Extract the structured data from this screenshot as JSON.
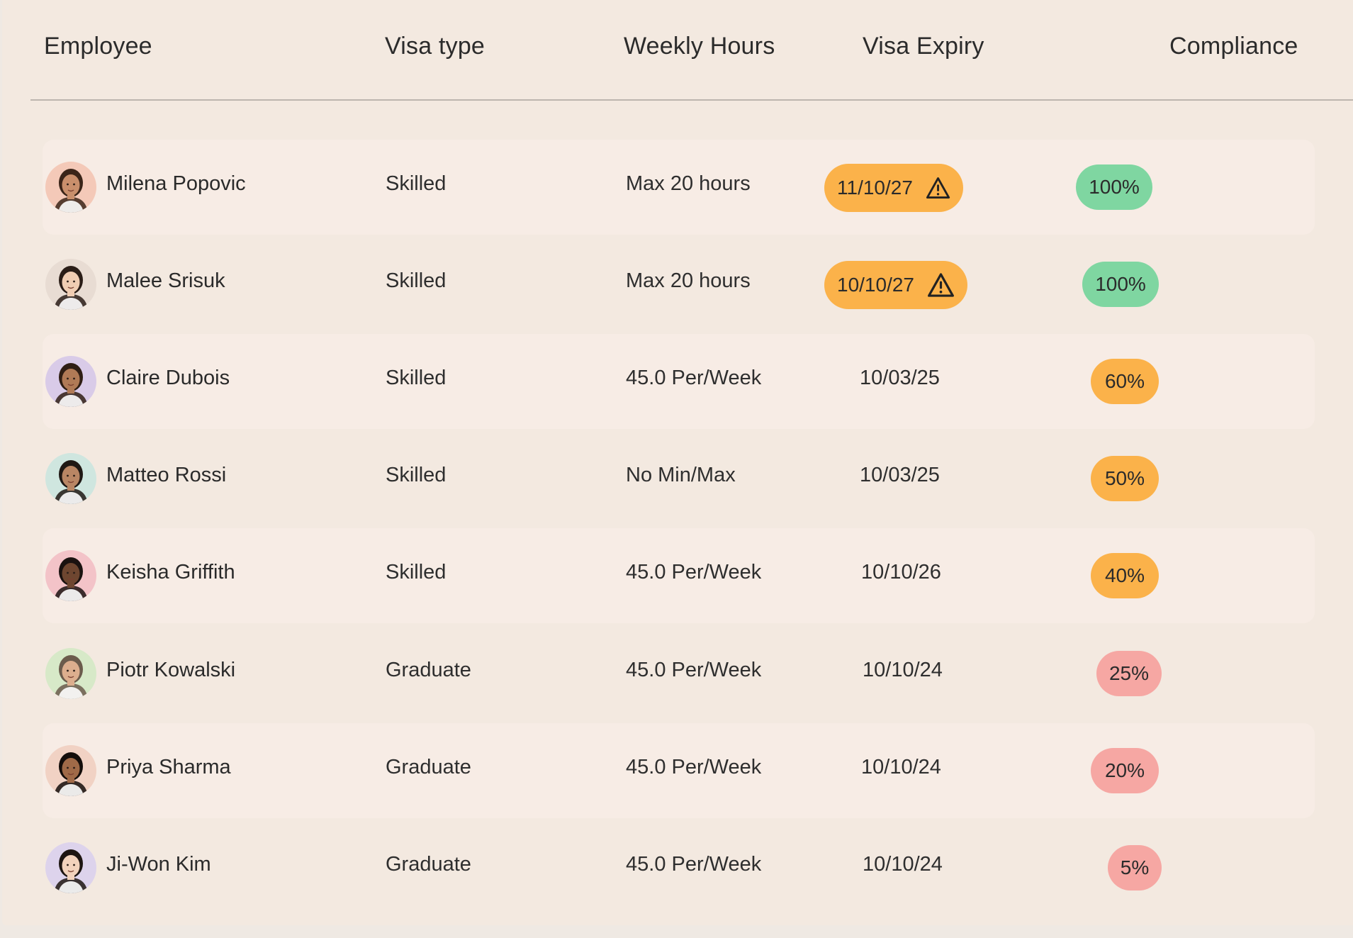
{
  "header": {
    "employee": "Employee",
    "visa_type": "Visa type",
    "weekly_hours": "Weekly Hours",
    "visa_expiry": "Visa Expiry",
    "compliance": "Compliance"
  },
  "colors": {
    "warning": "#fbb24a",
    "good": "#7fd6a1",
    "medium": "#fbb24a",
    "bad": "#f6a7a3"
  },
  "rows": [
    {
      "name": "Milena Popovic",
      "visa": "Skilled",
      "hours": "Max 20 hours",
      "expiry": "11/10/27",
      "expiry_warning": true,
      "compliance": "100%",
      "compliance_level": "good",
      "avatar_icon": "person-avatar-icon"
    },
    {
      "name": "Malee Srisuk",
      "visa": "Skilled",
      "hours": "Max 20 hours",
      "expiry": "10/10/27",
      "expiry_warning": true,
      "compliance": "100%",
      "compliance_level": "good",
      "avatar_icon": "person-avatar-icon"
    },
    {
      "name": "Claire Dubois",
      "visa": "Skilled",
      "hours": "45.0 Per/Week",
      "expiry": "10/03/25",
      "expiry_warning": false,
      "compliance": "60%",
      "compliance_level": "medium",
      "avatar_icon": "person-avatar-icon"
    },
    {
      "name": "Matteo Rossi",
      "visa": "Skilled",
      "hours": "No Min/Max",
      "expiry": "10/03/25",
      "expiry_warning": false,
      "compliance": "50%",
      "compliance_level": "medium",
      "avatar_icon": "person-avatar-icon"
    },
    {
      "name": "Keisha Griffith",
      "visa": "Skilled",
      "hours": "45.0 Per/Week",
      "expiry": "10/10/26",
      "expiry_warning": false,
      "compliance": "40%",
      "compliance_level": "medium",
      "avatar_icon": "person-avatar-icon"
    },
    {
      "name": "Piotr Kowalski",
      "visa": "Graduate",
      "hours": "45.0 Per/Week",
      "expiry": "10/10/24",
      "expiry_warning": false,
      "compliance": "25%",
      "compliance_level": "bad",
      "avatar_icon": "person-avatar-icon"
    },
    {
      "name": "Priya Sharma",
      "visa": "Graduate",
      "hours": "45.0 Per/Week",
      "expiry": "10/10/24",
      "expiry_warning": false,
      "compliance": "20%",
      "compliance_level": "bad",
      "avatar_icon": "person-avatar-icon"
    },
    {
      "name": "Ji-Won Kim",
      "visa": "Graduate",
      "hours": "45.0 Per/Week",
      "expiry": "10/10/24",
      "expiry_warning": false,
      "compliance": "5%",
      "compliance_level": "bad",
      "avatar_icon": "person-avatar-icon"
    }
  ]
}
